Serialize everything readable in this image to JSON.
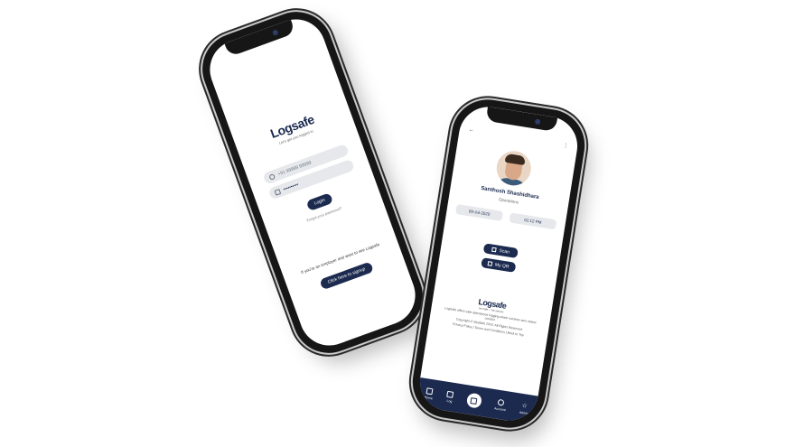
{
  "phone1": {
    "logo": "Logsafe",
    "tagline": "Let's get you logged in",
    "phone_value": "+91 99999 99999",
    "password_value": "••••••••••",
    "login_label": "Login",
    "forgot_label": "Forgot your password?",
    "employer_text": "If you're an employer and want to see Logsafe",
    "signup_label": "Click here to signup"
  },
  "phone2": {
    "back_icon": "arrow-left-icon",
    "user_name": "Santhosh Shashidhara",
    "user_role": "Operations",
    "date": "09-Jul-2020",
    "time": "01:12 PM",
    "scan_label": "Scan",
    "myqr_label": "My QR",
    "logo": "Logsafe",
    "logo_sub": "be safe  ✓  be secure",
    "desc": "LogSafe offers safe attendance logging which involves zero object contact",
    "copyright": "Copyright © Strabble 2020. All Rights Reserved",
    "links": "Privacy Policy | Terms and Conditions | Back to Top",
    "nav": [
      "Home",
      "Log",
      "",
      "Account",
      "Admin"
    ]
  },
  "colors": {
    "brand": "#1b2a4e",
    "field": "#e6e8ec"
  }
}
